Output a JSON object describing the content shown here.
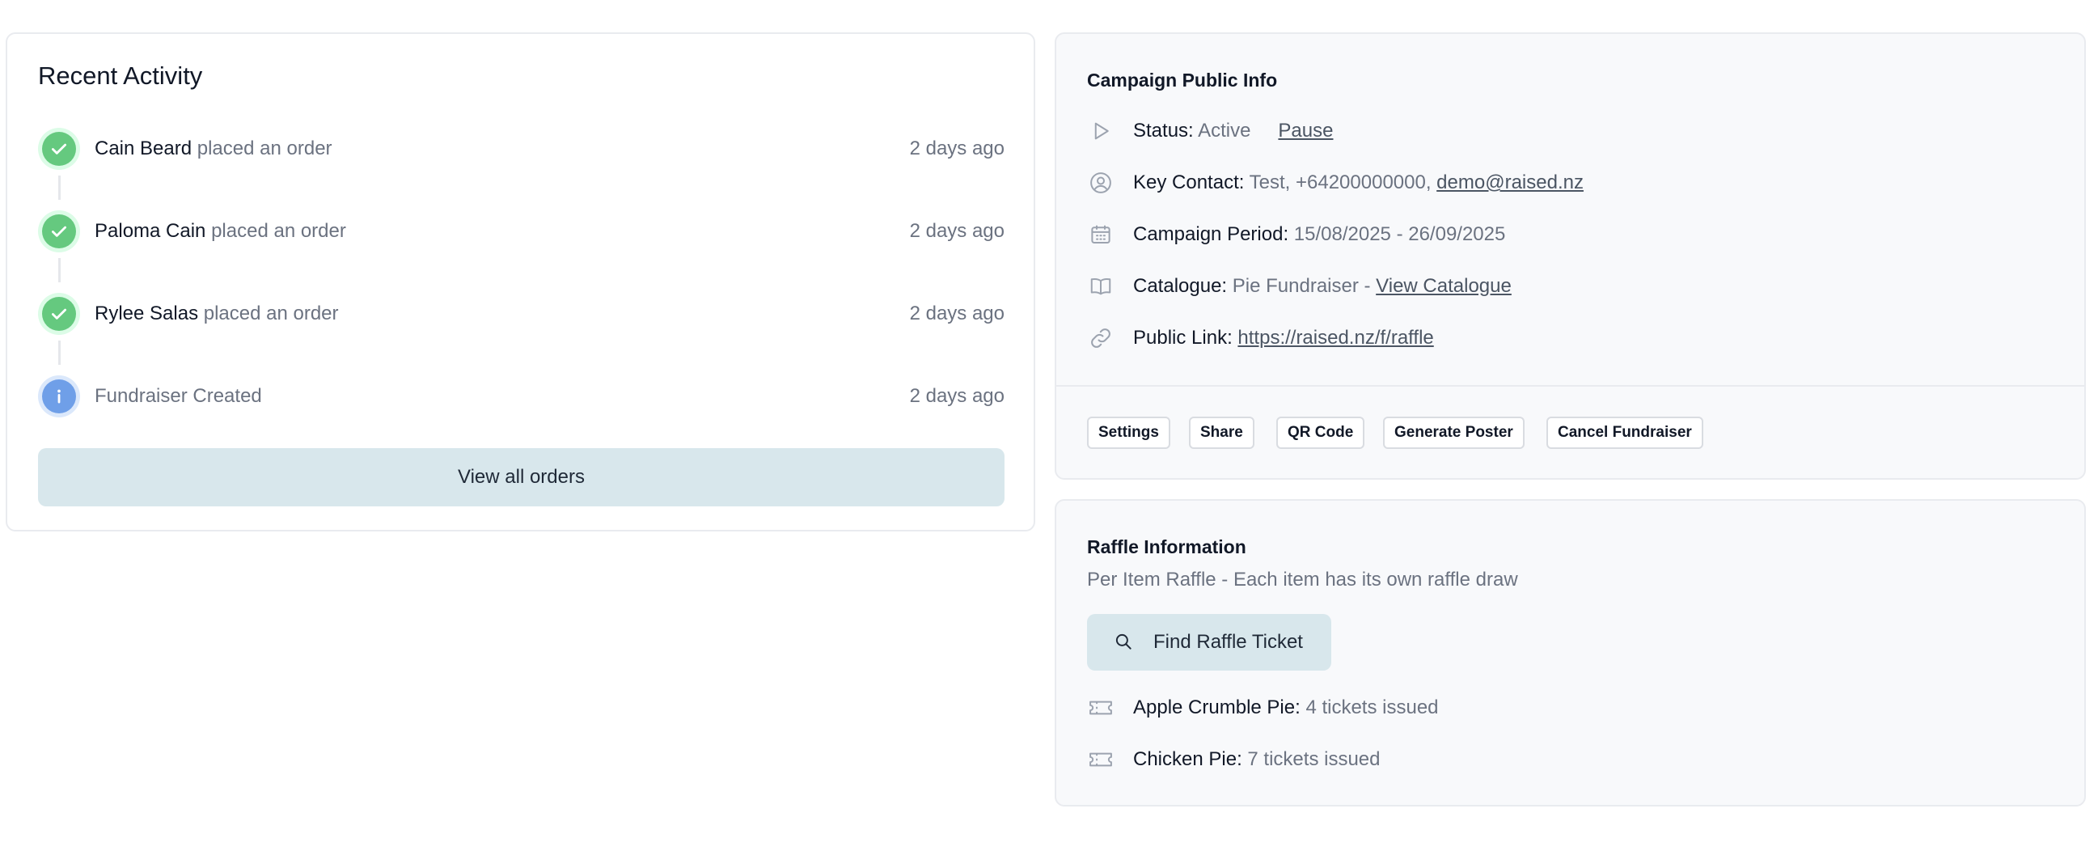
{
  "activity": {
    "title": "Recent Activity",
    "items": [
      {
        "name": "Cain Beard",
        "action": "placed an order",
        "time": "2 days ago",
        "type": "success"
      },
      {
        "name": "Paloma Cain",
        "action": "placed an order",
        "time": "2 days ago",
        "type": "success"
      },
      {
        "name": "Rylee Salas",
        "action": "placed an order",
        "time": "2 days ago",
        "type": "success"
      },
      {
        "name": "",
        "action": "Fundraiser Created",
        "time": "2 days ago",
        "type": "info"
      }
    ],
    "view_all_label": "View all orders"
  },
  "campaign": {
    "title": "Campaign Public Info",
    "status": {
      "label": "Status:",
      "value": "Active",
      "action": "Pause",
      "icon": "play-icon"
    },
    "contact": {
      "label": "Key Contact:",
      "value": "Test, +64200000000,",
      "email": "demo@raised.nz",
      "icon": "user-circle-icon"
    },
    "period": {
      "label": "Campaign Period:",
      "value": "15/08/2025 - 26/09/2025",
      "icon": "calendar-icon"
    },
    "catalogue": {
      "label": "Catalogue:",
      "value": "Pie Fundraiser -",
      "link": "View Catalogue",
      "icon": "book-open-icon"
    },
    "public_link": {
      "label": "Public Link:",
      "url": "https://raised.nz/f/raffle",
      "icon": "link-icon"
    },
    "buttons": {
      "settings": "Settings",
      "share": "Share",
      "qr_code": "QR Code",
      "generate_poster": "Generate Poster",
      "cancel": "Cancel Fundraiser"
    }
  },
  "raffle": {
    "title": "Raffle Information",
    "description": "Per Item Raffle - Each item has its own raffle draw",
    "find_label": "Find Raffle Ticket",
    "items": [
      {
        "label": "Apple Crumble Pie:",
        "value": "4 tickets issued",
        "icon": "ticket-icon"
      },
      {
        "label": "Chicken Pie:",
        "value": "7 tickets issued",
        "icon": "ticket-icon"
      }
    ]
  },
  "colors": {
    "success": "#65c97f",
    "info": "#6f9fe8",
    "button_bg": "#d8e7ec",
    "card_bg": "#f8f9fb"
  }
}
